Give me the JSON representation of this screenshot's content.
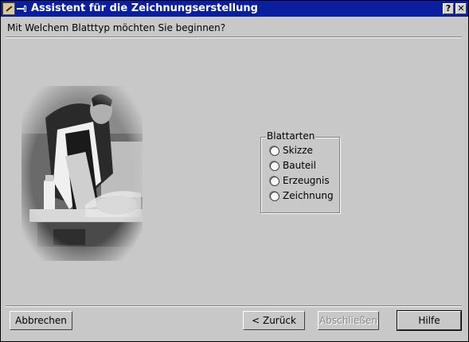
{
  "window": {
    "title": "Assistent für die Zeichnungserstellung"
  },
  "titlebar": {
    "help_label": "?",
    "close_label": "✕"
  },
  "question": "Mit Welchem Blatttyp möchten Sie beginnen?",
  "group": {
    "label": "Blattarten",
    "options": [
      {
        "label": "Skizze",
        "selected": false
      },
      {
        "label": "Bauteil",
        "selected": false
      },
      {
        "label": "Erzeugnis",
        "selected": false
      },
      {
        "label": "Zeichnung",
        "selected": false
      }
    ]
  },
  "buttons": {
    "cancel": "Abbrechen",
    "back": "< Zurück",
    "finish": "Abschließen",
    "help": "Hilfe"
  },
  "icons": [
    "app-icon",
    "pin-icon",
    "help-icon",
    "close-icon",
    "radio-icon"
  ]
}
